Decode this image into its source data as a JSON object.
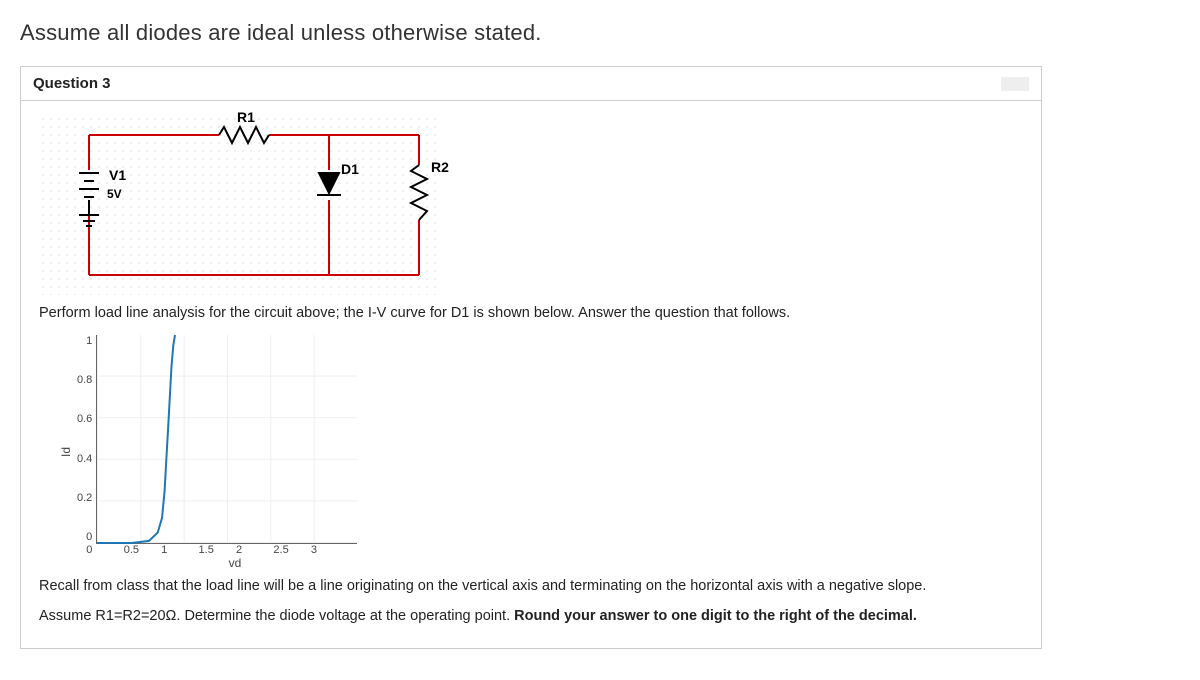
{
  "instruction": "Assume all diodes are ideal unless otherwise stated.",
  "question": {
    "number_label": "Question 3",
    "circuit": {
      "R1": "R1",
      "V1": "V1",
      "V1val": "5V",
      "D1": "D1",
      "R2": "R2"
    },
    "para1": "Perform load line analysis for the circuit above; the I-V curve for D1 is shown below. Answer the question that follows.",
    "para2_a": "Recall from class that the load line will be a line originating on the vertical axis and terminating on the horizontal axis with a negative slope.",
    "para2_b": "Assume R1=R2=20Ω. Determine the diode voltage at the operating point. ",
    "para2_c": "Round your answer to one digit to the right of the decimal."
  },
  "chart_data": {
    "type": "line",
    "title": "",
    "xlabel": "vd",
    "ylabel": "Id",
    "xlim": [
      0,
      3
    ],
    "ylim": [
      0,
      1
    ],
    "xticks": [
      "0",
      "0.5",
      "1",
      "1.5",
      "2",
      "2.5",
      "3"
    ],
    "yticks": [
      "0",
      "0.2",
      "0.4",
      "0.6",
      "0.8",
      "1"
    ],
    "series": [
      {
        "name": "D1 I-V curve",
        "color": "#1f77b4",
        "x": [
          0,
          0.4,
          0.6,
          0.7,
          0.75,
          0.78,
          0.8,
          0.82,
          0.84,
          0.86,
          0.88,
          0.9
        ],
        "id": [
          0,
          0,
          0.01,
          0.05,
          0.12,
          0.25,
          0.4,
          0.55,
          0.7,
          0.85,
          0.95,
          1.0
        ]
      }
    ]
  }
}
